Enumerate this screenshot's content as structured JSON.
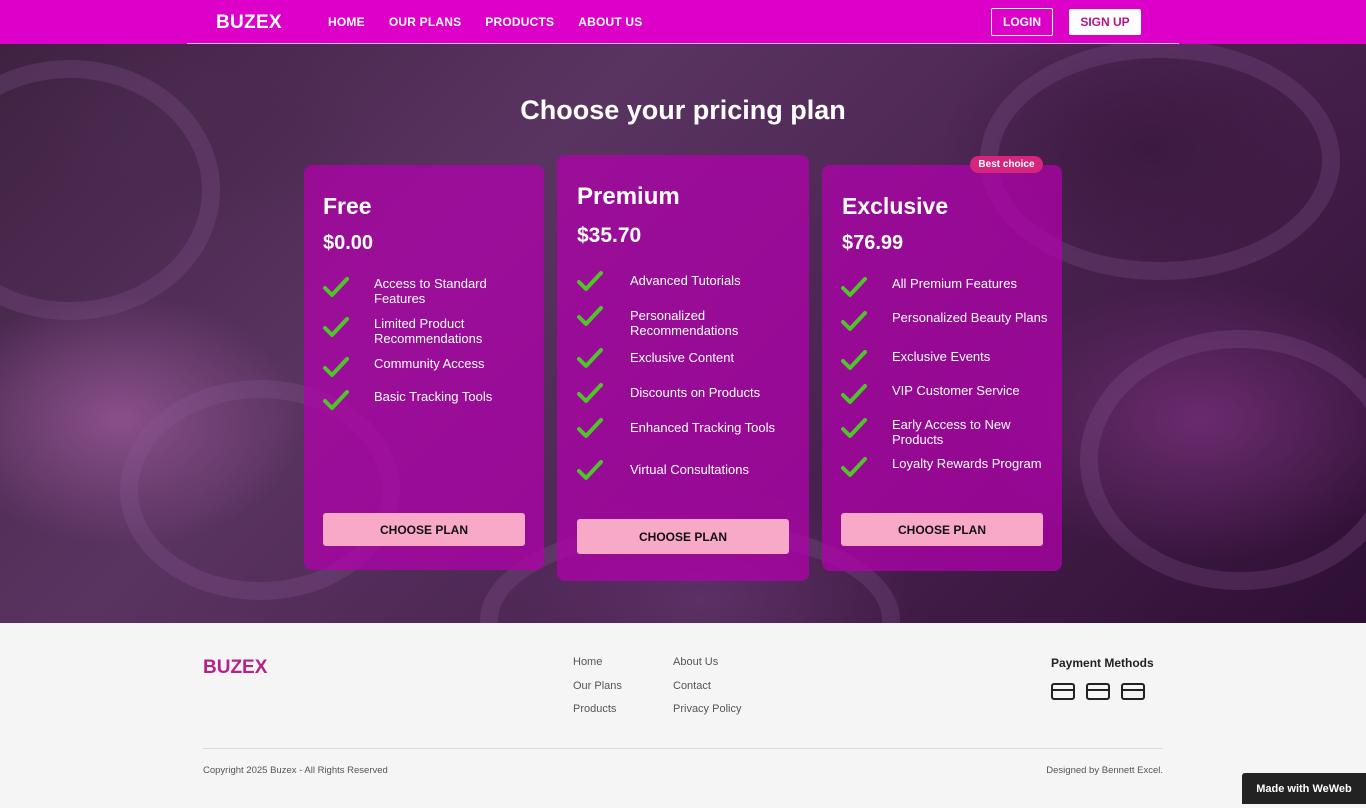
{
  "brand": "BUZEX",
  "nav": {
    "links": [
      "HOME",
      "OUR PLANS",
      "PRODUCTS",
      "ABOUT US"
    ],
    "login": "LOGIN",
    "signup": "SIGN UP"
  },
  "page_title": "Choose your pricing plan",
  "plans": [
    {
      "name": "Free",
      "price": "$0.00",
      "features": [
        "Access to Standard Features",
        "Limited Product Recommendations",
        "Community Access",
        "Basic Tracking Tools"
      ],
      "button": "CHOOSE PLAN"
    },
    {
      "name": "Premium",
      "price": "$35.70",
      "features": [
        "Advanced Tutorials",
        "Personalized Recommendations",
        "Exclusive Content",
        "Discounts on Products",
        "Enhanced Tracking Tools",
        "Virtual Consultations"
      ],
      "button": "CHOOSE PLAN"
    },
    {
      "name": "Exclusive",
      "price": "$76.99",
      "badge": "Best choice",
      "features": [
        "All Premium Features",
        "Personalized Beauty Plans",
        "Exclusive Events",
        "VIP Customer Service",
        "Early Access to New Products",
        "Loyalty Rewards Program"
      ],
      "button": "CHOOSE PLAN"
    }
  ],
  "footer": {
    "brand": "BUZEX",
    "col1": [
      "Home",
      "Our Plans",
      "Products"
    ],
    "col2": [
      "About Us",
      "Contact",
      "Privacy Policy"
    ],
    "payment_title": "Payment Methods",
    "payment_icons": [
      "credit-card-icon",
      "credit-card-icon",
      "credit-card-icon"
    ],
    "copyright": "Copyright 2025 Buzex - All Rights Reserved",
    "designed_by": "Designed by Bennett Excel."
  },
  "made_with": "Made with WeWeb",
  "colors": {
    "nav_bg": "#dc00c8",
    "card_bg": "#b400af",
    "button_bg": "#f9a9c8",
    "badge_bg": "#d5257d",
    "footer_brand": "#b5238a"
  }
}
